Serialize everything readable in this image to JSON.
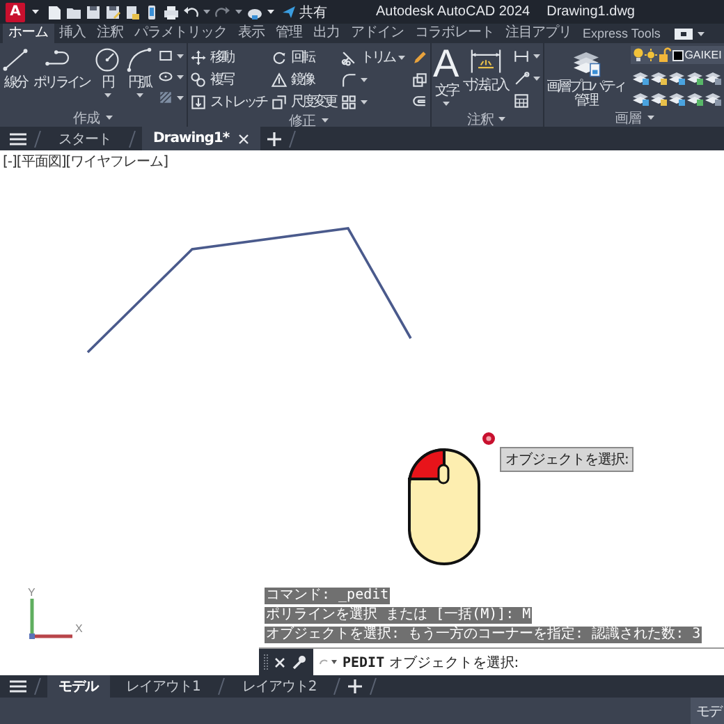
{
  "title_bar": {
    "app_letter": "A",
    "share": "共有",
    "title": "Autodesk AutoCAD 2024",
    "document": "Drawing1.dwg"
  },
  "ribbon_tabs": [
    {
      "label": "ホーム",
      "selected": true
    },
    {
      "label": "挿入",
      "selected": false
    },
    {
      "label": "注釈",
      "selected": false
    },
    {
      "label": "パラメトリック",
      "selected": false
    },
    {
      "label": "表示",
      "selected": false
    },
    {
      "label": "管理",
      "selected": false
    },
    {
      "label": "出力",
      "selected": false
    },
    {
      "label": "アドイン",
      "selected": false
    },
    {
      "label": "コラボレート",
      "selected": false
    },
    {
      "label": "注目アプリ",
      "selected": false
    },
    {
      "label": "Express Tools",
      "selected": false
    }
  ],
  "panels": [
    {
      "kind": "draw",
      "title": "作成",
      "tools": [
        {
          "label": "線分",
          "has_menu": false
        },
        {
          "label": "ポリライン",
          "has_menu": false
        },
        {
          "label": "円",
          "has_menu": true
        },
        {
          "label": "円弧",
          "has_menu": true
        }
      ]
    },
    {
      "kind": "modify",
      "title": "修正",
      "tools": [
        {
          "label": "移動",
          "has_menu": false
        },
        {
          "label": "回転",
          "has_menu": false
        },
        {
          "label": "トリム",
          "has_menu": true
        },
        {
          "label": "複写",
          "has_menu": false
        },
        {
          "label": "鏡像",
          "has_menu": false
        },
        {
          "label": "ストレッチ",
          "has_menu": false
        },
        {
          "label": "尺度変更",
          "has_menu": false
        }
      ]
    },
    {
      "kind": "annotate",
      "title": "注釈",
      "tools": [
        {
          "label": "文字",
          "glyph": "A",
          "has_menu": true
        },
        {
          "label": "寸法記入",
          "has_menu": false
        }
      ]
    },
    {
      "kind": "layers",
      "title": "画層",
      "tools": [
        {
          "label": "画層プロパティ管理",
          "has_menu": false
        }
      ],
      "current_layer": "GAIKEI"
    }
  ],
  "file_tabs": [
    {
      "label": "スタート",
      "selected": false,
      "closable": false
    },
    {
      "label": "Drawing1*",
      "selected": true,
      "closable": true
    }
  ],
  "viewport": {
    "label": "[-][平面図][ワイヤフレーム]",
    "tooltip": "オブジェクトを選択:",
    "ucs_x": "X",
    "ucs_y": "Y"
  },
  "command": {
    "history": [
      "コマンド: _pedit",
      "ポリラインを選択 または [一括(M)]: M",
      "オブジェクトを選択: もう一方のコーナーを指定: 認識された数: 3"
    ],
    "prompt": "**PEDIT** オブジェクトを選択:"
  },
  "layout_tabs": [
    {
      "label": "モデル",
      "selected": true
    },
    {
      "label": "レイアウト1",
      "selected": false
    },
    {
      "label": "レイアウト2",
      "selected": false
    }
  ],
  "status_bar": {
    "mode": "モデ"
  }
}
